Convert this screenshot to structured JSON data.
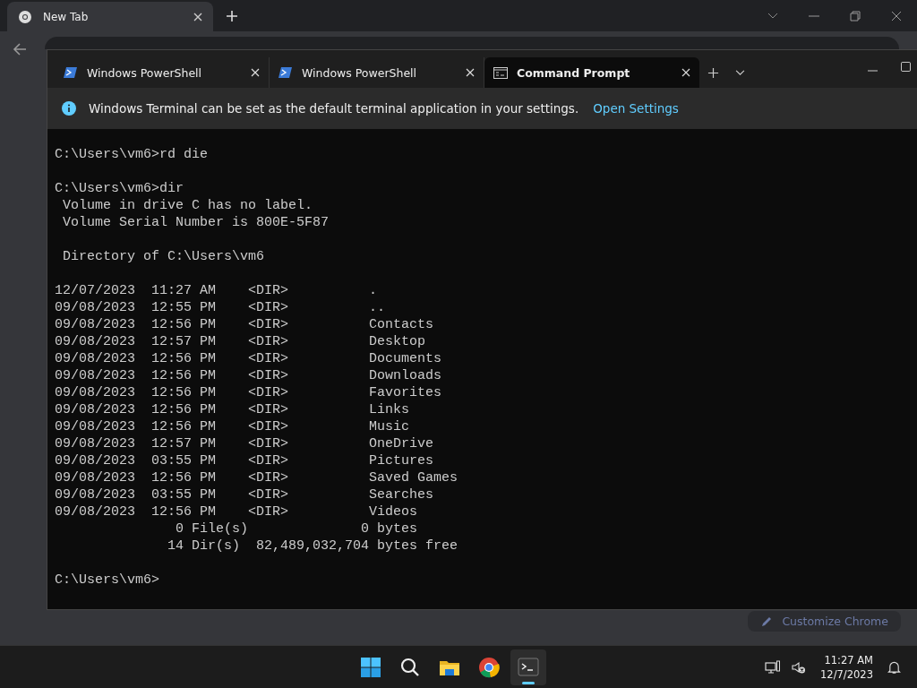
{
  "browser": {
    "tabs": [
      {
        "label": "New Tab",
        "selected": true
      }
    ]
  },
  "terminal": {
    "tabs": [
      {
        "label": "Windows PowerShell",
        "kind": "powershell",
        "selected": false
      },
      {
        "label": "Windows PowerShell",
        "kind": "powershell",
        "selected": false
      },
      {
        "label": "Command Prompt",
        "kind": "cmd",
        "selected": true
      }
    ],
    "infobar": {
      "message": "Windows Terminal can be set as the default terminal application in your settings.",
      "link": "Open Settings"
    },
    "blocks": [
      [
        "C:\\Users\\vm6>rd die"
      ],
      [
        "C:\\Users\\vm6>dir",
        " Volume in drive C has no label.",
        " Volume Serial Number is 800E-5F87"
      ],
      [
        " Directory of C:\\Users\\vm6"
      ],
      [
        "12/07/2023  11:27 AM    <DIR>          .",
        "09/08/2023  12:55 PM    <DIR>          ..",
        "09/08/2023  12:56 PM    <DIR>          Contacts",
        "09/08/2023  12:57 PM    <DIR>          Desktop",
        "09/08/2023  12:56 PM    <DIR>          Documents",
        "09/08/2023  12:56 PM    <DIR>          Downloads",
        "09/08/2023  12:56 PM    <DIR>          Favorites",
        "09/08/2023  12:56 PM    <DIR>          Links",
        "09/08/2023  12:56 PM    <DIR>          Music",
        "09/08/2023  12:57 PM    <DIR>          OneDrive",
        "09/08/2023  03:55 PM    <DIR>          Pictures",
        "09/08/2023  12:56 PM    <DIR>          Saved Games",
        "09/08/2023  03:55 PM    <DIR>          Searches",
        "09/08/2023  12:56 PM    <DIR>          Videos",
        "               0 File(s)              0 bytes",
        "              14 Dir(s)  82,489,032,704 bytes free"
      ],
      [
        "C:\\Users\\vm6>"
      ]
    ]
  },
  "customize_button": "Customize Chrome",
  "taskbar": {
    "apps": [
      {
        "kind": "start",
        "active": false
      },
      {
        "kind": "search",
        "active": false
      },
      {
        "kind": "files",
        "active": false
      },
      {
        "kind": "chrome",
        "active": false
      },
      {
        "kind": "terminal",
        "active": true
      }
    ],
    "time": "11:27 AM",
    "date": "12/7/2023"
  }
}
